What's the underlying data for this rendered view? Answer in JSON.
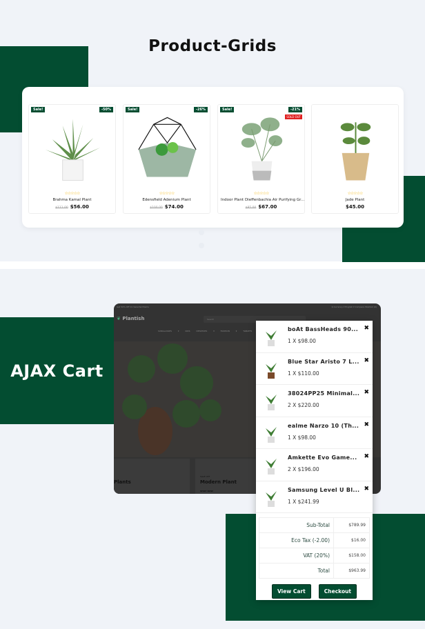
{
  "colors": {
    "brand": "#034d31",
    "sale_badge": "#034d31",
    "sold_out": "#e02020",
    "stars": "#f4b400"
  },
  "section1": {
    "title": "Product-Grids",
    "products": [
      {
        "name": "Brahma Kamal Plant",
        "old_price": "$111.00",
        "price": "$56.00",
        "sale": "Sale!",
        "discount": "-50%",
        "sold_out": "",
        "rating": 0
      },
      {
        "name": "Edensfield Adenium Plant",
        "old_price": "$100.00",
        "price": "$74.00",
        "sale": "Sale!",
        "discount": "-26%",
        "sold_out": "",
        "rating": 0
      },
      {
        "name": "Indoor Plant Dieffenbachia Air Purifying Gr...",
        "old_price": "$85.00",
        "price": "$67.00",
        "sale": "Sale!",
        "discount": "-21%",
        "sold_out": "SOLD OUT",
        "rating": 0
      },
      {
        "name": "Jade Plant",
        "old_price": "",
        "price": "$45.00",
        "sale": "",
        "discount": "",
        "sold_out": "",
        "rating": 0
      }
    ]
  },
  "section2": {
    "title": "AJAX Cart",
    "site": {
      "topbar": "Get 50% Off On Selected Items",
      "topbar_right": "$ Currency ▾   English ▾   Compare   Wishlist (0)",
      "logo": "Plantish",
      "search_placeholder": "Search",
      "nav": "SUNGLASSES ▾ KIDS DESKTOPS ▾ FASHION ▾ TABLETS",
      "banner1": "Plants",
      "banner2_kicker": "SALE OFF",
      "banner2": "Modern Plant",
      "banner2_link": "SHOP NOW"
    },
    "cart": {
      "items": [
        {
          "name": "boAt BassHeads 90...",
          "qty": "1 X $98.00"
        },
        {
          "name": "Blue Star Aristo 7 L...",
          "qty": "1 X $110.00"
        },
        {
          "name": "38024PP25 Minimal...",
          "qty": "2 X $220.00"
        },
        {
          "name": "ealme Narzo 10 (Th...",
          "qty": "1 X $98.00"
        },
        {
          "name": "Amkette Evo Game...",
          "qty": "2 X $196.00"
        },
        {
          "name": "Samsung Level U Bl...",
          "qty": "1 X $241.99"
        }
      ],
      "close": "✖",
      "totals": [
        {
          "label": "Sub-Total",
          "value": "$789.99"
        },
        {
          "label": "Eco Tax (-2.00)",
          "value": "$16.00"
        },
        {
          "label": "VAT (20%)",
          "value": "$158.00"
        },
        {
          "label": "Total",
          "value": "$963.99"
        }
      ],
      "view_cart": "View Cart",
      "checkout": "Checkout"
    }
  }
}
